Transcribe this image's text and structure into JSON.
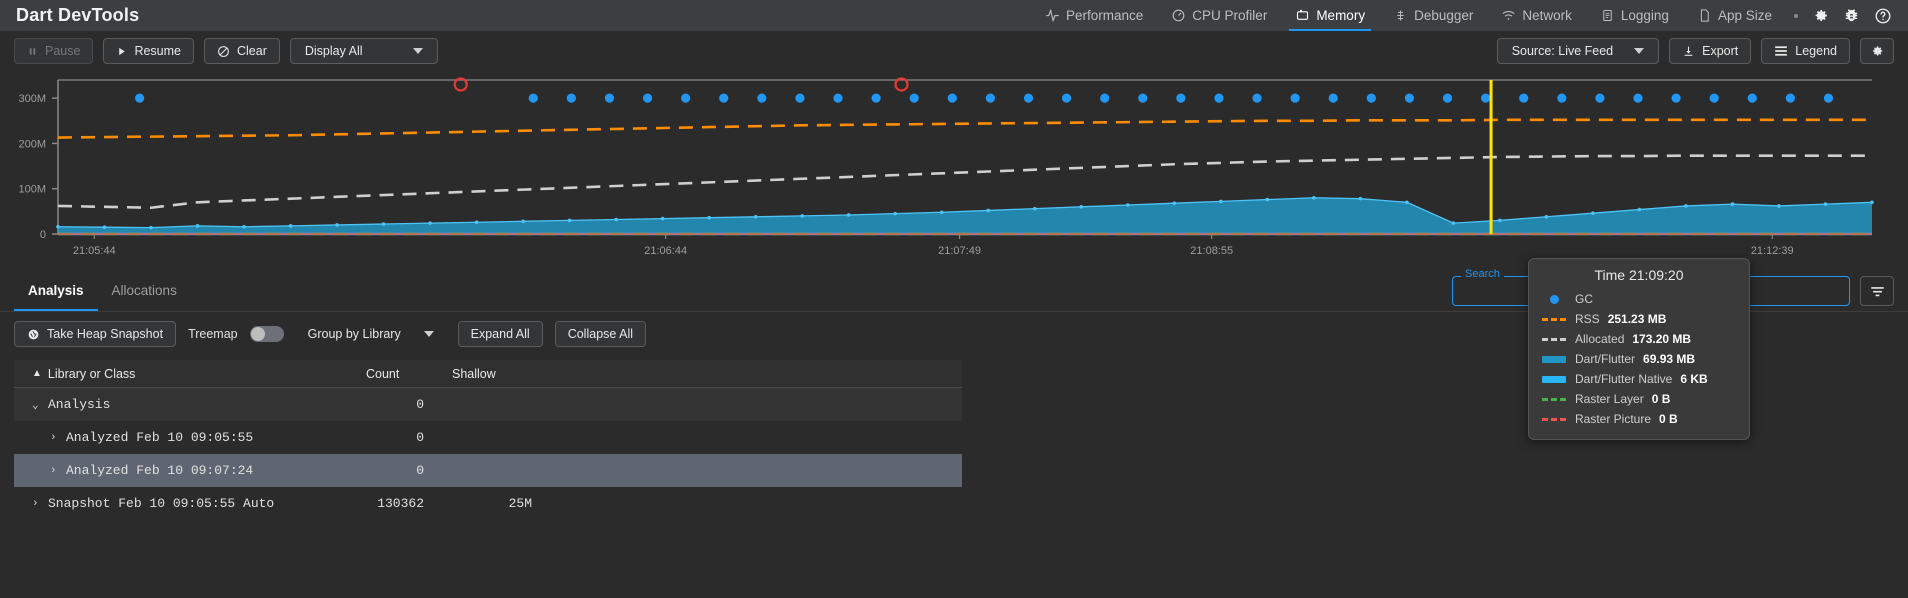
{
  "app": {
    "title": "Dart DevTools"
  },
  "tabs": [
    {
      "label": "Performance",
      "icon": "pulse-icon",
      "active": false
    },
    {
      "label": "CPU Profiler",
      "icon": "speedometer-icon",
      "active": false
    },
    {
      "label": "Memory",
      "icon": "memory-chip-icon",
      "active": true
    },
    {
      "label": "Debugger",
      "icon": "bug-steps-icon",
      "active": false
    },
    {
      "label": "Network",
      "icon": "wifi-icon",
      "active": false
    },
    {
      "label": "Logging",
      "icon": "clipboard-icon",
      "active": false
    },
    {
      "label": "App Size",
      "icon": "file-icon",
      "active": false
    }
  ],
  "top_icons": [
    {
      "name": "settings-gear-icon"
    },
    {
      "name": "report-bug-icon"
    },
    {
      "name": "help-icon"
    }
  ],
  "chart_toolbar": {
    "pause": "Pause",
    "resume": "Resume",
    "clear": "Clear",
    "display_all": "Display All",
    "source": "Source: Live Feed",
    "export": "Export",
    "legend": "Legend"
  },
  "tooltip": {
    "title": "Time 21:09:20",
    "rows": [
      {
        "label": "GC",
        "value": "",
        "marker": "circle",
        "color": "#2196f3"
      },
      {
        "label": "RSS",
        "value": "251.23 MB",
        "marker": "dashes",
        "color": "#ff8c00"
      },
      {
        "label": "Allocated",
        "value": "173.20 MB",
        "marker": "dashes",
        "color": "#cfcfcf"
      },
      {
        "label": "Dart/Flutter",
        "value": "69.93 MB",
        "marker": "bar",
        "color": "#2196c4"
      },
      {
        "label": "Dart/Flutter Native",
        "value": "6 KB",
        "marker": "bar",
        "color": "#29b6f6"
      },
      {
        "label": "Raster Layer",
        "value": "0 B",
        "marker": "dashes",
        "color": "#4caf50"
      },
      {
        "label": "Raster Picture",
        "value": "0 B",
        "marker": "dashes",
        "color": "#ef5350"
      }
    ]
  },
  "chart_data": {
    "type": "area",
    "title": "Memory timeline",
    "xlabel": "",
    "ylabel": "",
    "ylim": [
      0,
      340
    ],
    "yticks": [
      0,
      100,
      200,
      300
    ],
    "ytick_labels": [
      "0",
      "100M",
      "200M",
      "300M"
    ],
    "xtick_labels": [
      "21:05:44",
      "21:06:44",
      "21:07:49",
      "21:08:55",
      "21:12:39"
    ],
    "xtick_positions": [
      0.02,
      0.335,
      0.497,
      0.636,
      0.945
    ],
    "grid": false,
    "legend_position": "overlay-tooltip",
    "selection_time": "21:09:20",
    "selection_x": 0.79,
    "series": [
      {
        "name": "RSS",
        "style": "dashed",
        "color": "#ff8c00",
        "values": [
          213,
          214,
          215,
          216,
          217,
          218,
          220,
          222,
          224,
          226,
          228,
          230,
          232,
          234,
          236,
          238,
          240,
          241,
          242,
          243,
          244,
          245,
          246,
          247,
          248,
          249,
          250,
          250,
          251,
          251,
          251,
          252,
          252,
          252,
          252,
          252,
          252,
          252,
          252,
          252
        ]
      },
      {
        "name": "Allocated",
        "style": "dashed",
        "color": "#cfcfcf",
        "values": [
          62,
          60,
          58,
          70,
          74,
          78,
          82,
          86,
          90,
          94,
          98,
          102,
          106,
          110,
          114,
          118,
          122,
          126,
          130,
          134,
          138,
          142,
          146,
          150,
          154,
          157,
          160,
          162,
          164,
          166,
          168,
          170,
          171,
          172,
          172,
          173,
          173,
          173,
          173,
          173
        ]
      },
      {
        "name": "Dart/Flutter",
        "style": "area",
        "color": "#2196c4",
        "values": [
          16,
          15,
          14,
          18,
          16,
          18,
          20,
          22,
          24,
          26,
          28,
          30,
          32,
          34,
          36,
          38,
          40,
          42,
          45,
          48,
          52,
          56,
          60,
          64,
          68,
          72,
          76,
          80,
          78,
          70,
          24,
          30,
          38,
          46,
          54,
          62,
          66,
          62,
          66,
          70
        ]
      },
      {
        "name": "Dart/Flutter Native",
        "style": "line",
        "color": "#29b6f6",
        "values": [
          0.006,
          0.006,
          0.006,
          0.006,
          0.006,
          0.006,
          0.006,
          0.006,
          0.006,
          0.006,
          0.006,
          0.006,
          0.006,
          0.006,
          0.006,
          0.006,
          0.006,
          0.006,
          0.006,
          0.006,
          0.006,
          0.006,
          0.006,
          0.006,
          0.006,
          0.006,
          0.006,
          0.006,
          0.006,
          0.006,
          0.006,
          0.006,
          0.006,
          0.006,
          0.006,
          0.006,
          0.006,
          0.006,
          0.006,
          0.006
        ]
      },
      {
        "name": "Raster Layer",
        "style": "dashed",
        "color": "#4caf50",
        "values": [
          0,
          0,
          0,
          0,
          0,
          0,
          0,
          0,
          0,
          0,
          0,
          0,
          0,
          0,
          0,
          0,
          0,
          0,
          0,
          0,
          0,
          0,
          0,
          0,
          0,
          0,
          0,
          0,
          0,
          0,
          0,
          0,
          0,
          0,
          0,
          0,
          0,
          0,
          0,
          0
        ]
      },
      {
        "name": "Raster Picture",
        "style": "solid",
        "color": "#ef5350",
        "values": [
          0,
          0,
          0,
          0,
          0,
          0,
          0,
          0,
          0,
          0,
          0,
          0,
          0,
          0,
          0,
          0,
          0,
          0,
          0,
          0,
          0,
          0,
          0,
          0,
          0,
          0,
          0,
          0,
          0,
          0,
          0,
          0,
          0,
          0,
          0,
          0,
          0,
          0,
          0,
          0
        ]
      }
    ],
    "gc_events": {
      "name": "GC",
      "color": "#2196f3",
      "y": 300,
      "x_positions": [
        0.045,
        0.262,
        0.283,
        0.304,
        0.325,
        0.346,
        0.367,
        0.388,
        0.409,
        0.43,
        0.451,
        0.472,
        0.493,
        0.514,
        0.535,
        0.556,
        0.577,
        0.598,
        0.619,
        0.64,
        0.661,
        0.682,
        0.703,
        0.724,
        0.745,
        0.766,
        0.787,
        0.808,
        0.829,
        0.85,
        0.871,
        0.892,
        0.913,
        0.934,
        0.955,
        0.976
      ]
    },
    "snapshot_markers": {
      "name": "Snapshot",
      "color": "#e53935",
      "y": 330,
      "x_positions": [
        0.222,
        0.465
      ]
    }
  },
  "analysis": {
    "tabs": [
      {
        "label": "Analysis",
        "active": true
      },
      {
        "label": "Allocations",
        "active": false
      }
    ],
    "search_label": "Search",
    "search_value": "",
    "search_placeholder": ""
  },
  "snap_toolbar": {
    "take_snapshot": "Take Heap Snapshot",
    "treemap_label": "Treemap",
    "treemap_on": false,
    "group_by": "Group by Library",
    "expand_all": "Expand All",
    "collapse_all": "Collapse All"
  },
  "table": {
    "columns": [
      "Library or Class",
      "Count",
      "Shallow"
    ],
    "sort_column": "Library or Class",
    "sort_direction": "asc",
    "rows": [
      {
        "name": "Analysis",
        "count": "0",
        "shallow": "",
        "indent": 1,
        "expanded": true,
        "selected": false
      },
      {
        "name": "Analyzed Feb 10 09:05:55",
        "count": "0",
        "shallow": "",
        "indent": 2,
        "expanded": false,
        "selected": false
      },
      {
        "name": "Analyzed Feb 10 09:07:24",
        "count": "0",
        "shallow": "",
        "indent": 2,
        "expanded": false,
        "selected": true
      },
      {
        "name": "Snapshot Feb 10 09:05:55 Auto",
        "count": "130362",
        "shallow": "25M",
        "indent": 1,
        "expanded": false,
        "selected": false
      }
    ]
  }
}
